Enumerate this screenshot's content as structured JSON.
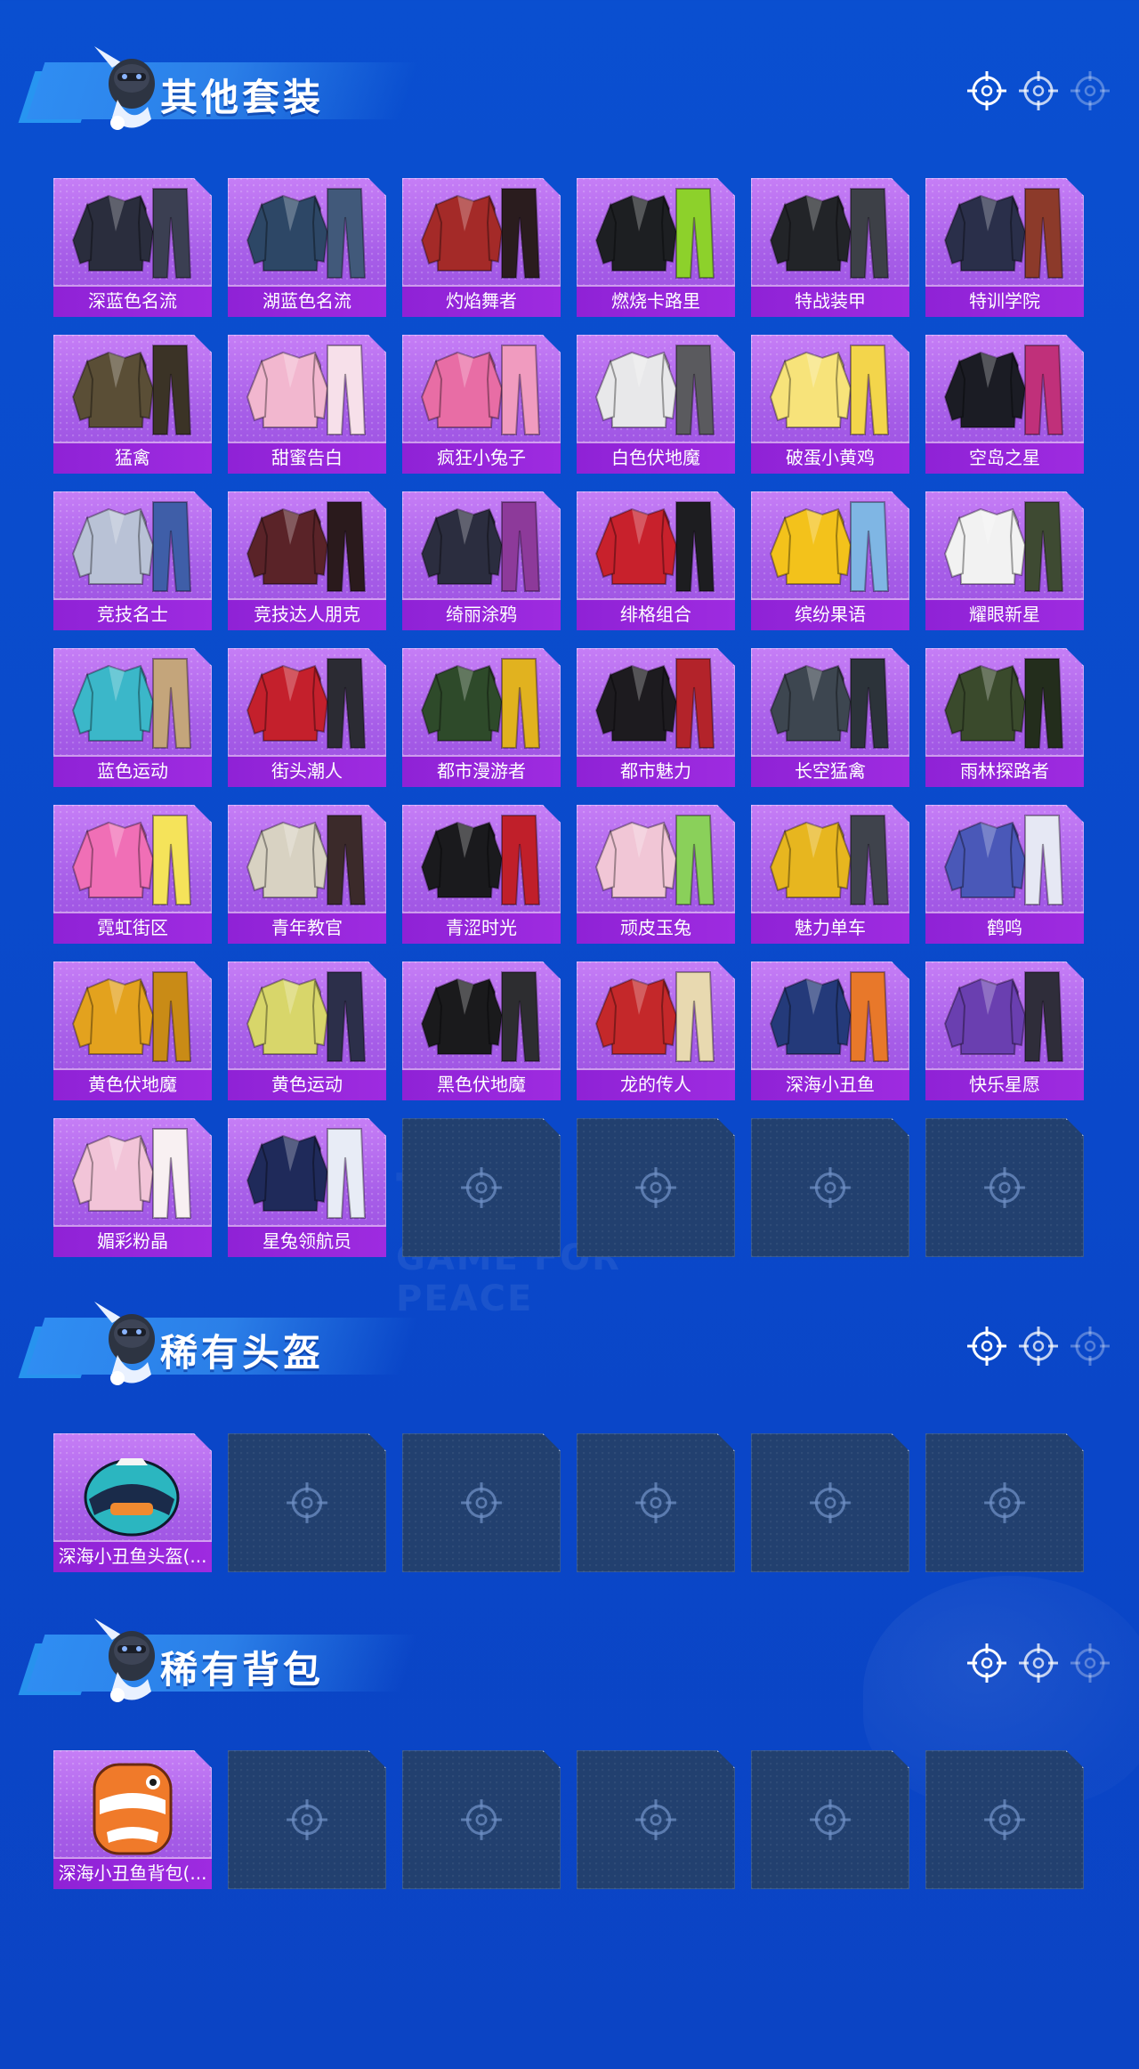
{
  "colors": {
    "background": "#0a4bcc",
    "card_filled": "#b06cf0",
    "card_label": "#9526dc",
    "card_empty": "#22406f"
  },
  "watermark": "GAME FOR PEACE",
  "sections": [
    {
      "title": "其他套装",
      "items": [
        {
          "name": "深蓝色名流",
          "art": "suit-icon",
          "c1": "#2a2d3d",
          "c2": "#3b3f52"
        },
        {
          "name": "湖蓝色名流",
          "art": "suit-icon",
          "c1": "#2d4766",
          "c2": "#41597a"
        },
        {
          "name": "灼焰舞者",
          "art": "outfit-icon",
          "c1": "#a42a28",
          "c2": "#2a1c1e"
        },
        {
          "name": "燃烧卡路里",
          "art": "outfit-icon",
          "c1": "#1d1f22",
          "c2": "#8dd12b"
        },
        {
          "name": "特战装甲",
          "art": "outfit-icon",
          "c1": "#222428",
          "c2": "#3d4047"
        },
        {
          "name": "特训学院",
          "art": "outfit-icon",
          "c1": "#2a2f4a",
          "c2": "#8c3a2a"
        },
        {
          "name": "猛禽",
          "art": "outfit-icon",
          "c1": "#5a4e36",
          "c2": "#3b3326"
        },
        {
          "name": "甜蜜告白",
          "art": "outfit-icon",
          "c1": "#f2b7cf",
          "c2": "#f7e0ea"
        },
        {
          "name": "疯狂小兔子",
          "art": "outfit-icon",
          "c1": "#e86da5",
          "c2": "#f09bbf"
        },
        {
          "name": "白色伏地魔",
          "art": "outfit-icon",
          "c1": "#e8e8ea",
          "c2": "#5a5a5e"
        },
        {
          "name": "破蛋小黄鸡",
          "art": "outfit-icon",
          "c1": "#f7e37a",
          "c2": "#f3d54b"
        },
        {
          "name": "空岛之星",
          "art": "outfit-icon",
          "c1": "#1b1c24",
          "c2": "#c0307a"
        },
        {
          "name": "竞技名士",
          "art": "outfit-icon",
          "c1": "#b9c2d6",
          "c2": "#3f5ea8"
        },
        {
          "name": "竞技达人朋克",
          "art": "outfit-icon",
          "c1": "#5a2328",
          "c2": "#2a1a1c"
        },
        {
          "name": "绮丽涂鸦",
          "art": "outfit-icon",
          "c1": "#2b2d3f",
          "c2": "#8d3a9a"
        },
        {
          "name": "绯格组合",
          "art": "outfit-icon",
          "c1": "#c8212c",
          "c2": "#1d1d20"
        },
        {
          "name": "缤纷果语",
          "art": "outfit-icon",
          "c1": "#f3c21b",
          "c2": "#7fb6e4"
        },
        {
          "name": "耀眼新星",
          "art": "outfit-icon",
          "c1": "#f2f2f2",
          "c2": "#3e4a32"
        },
        {
          "name": "蓝色运动",
          "art": "outfit-icon",
          "c1": "#3bb7c9",
          "c2": "#c4a57b"
        },
        {
          "name": "街头潮人",
          "art": "outfit-icon",
          "c1": "#c4202c",
          "c2": "#2b2b33"
        },
        {
          "name": "都市漫游者",
          "art": "outfit-icon",
          "c1": "#2e4a2a",
          "c2": "#e1b21f"
        },
        {
          "name": "都市魅力",
          "art": "outfit-icon",
          "c1": "#1d1b1f",
          "c2": "#b3232a"
        },
        {
          "name": "长空猛禽",
          "art": "outfit-icon",
          "c1": "#3d4650",
          "c2": "#2c333a"
        },
        {
          "name": "雨林探路者",
          "art": "outfit-icon",
          "c1": "#3a4a2c",
          "c2": "#232d1c"
        },
        {
          "name": "霓虹街区",
          "art": "outfit-icon",
          "c1": "#f06fb6",
          "c2": "#f5e35a"
        },
        {
          "name": "青年教官",
          "art": "outfit-icon",
          "c1": "#d8d2c2",
          "c2": "#3b2a2a"
        },
        {
          "name": "青涩时光",
          "art": "outfit-icon",
          "c1": "#1a1a1d",
          "c2": "#c01f2a"
        },
        {
          "name": "顽皮玉兔",
          "art": "outfit-icon",
          "c1": "#f1c6d6",
          "c2": "#8ad05a"
        },
        {
          "name": "魅力单车",
          "art": "outfit-icon",
          "c1": "#e7b61f",
          "c2": "#3f434c"
        },
        {
          "name": "鹤鸣",
          "art": "outfit-icon",
          "c1": "#4a58b8",
          "c2": "#e6e8f4"
        },
        {
          "name": "黄色伏地魔",
          "art": "outfit-icon",
          "c1": "#e3a21e",
          "c2": "#c98b16"
        },
        {
          "name": "黄色运动",
          "art": "outfit-icon",
          "c1": "#d8d66a",
          "c2": "#2c2f4a"
        },
        {
          "name": "黑色伏地魔",
          "art": "outfit-icon",
          "c1": "#1a1a1c",
          "c2": "#2d2d30"
        },
        {
          "name": "龙的传人",
          "art": "outfit-icon",
          "c1": "#c4282a",
          "c2": "#e8d9b0"
        },
        {
          "name": "深海小丑鱼",
          "art": "outfit-icon",
          "c1": "#243a7a",
          "c2": "#e8782a"
        },
        {
          "name": "快乐星愿",
          "art": "outfit-icon",
          "c1": "#6a3fb0",
          "c2": "#2f2d3a"
        },
        {
          "name": "媚彩粉晶",
          "art": "outfit-icon",
          "c1": "#f2c4d8",
          "c2": "#f8f0f2"
        },
        {
          "name": "星兔领航员",
          "art": "outfit-icon",
          "c1": "#1f2a5a",
          "c2": "#e8ecf6"
        }
      ],
      "empty_slots": 4
    },
    {
      "title": "稀有头盔",
      "items": [
        {
          "name": "深海小丑鱼头盔(...",
          "art": "helmet-icon",
          "c1": "#2bb6c0",
          "c2": "#1a2b4a"
        }
      ],
      "empty_slots": 5
    },
    {
      "title": "稀有背包",
      "items": [
        {
          "name": "深海小丑鱼背包(...",
          "art": "backpack-icon",
          "c1": "#f07a2a",
          "c2": "#ffffff"
        }
      ],
      "empty_slots": 5
    }
  ]
}
